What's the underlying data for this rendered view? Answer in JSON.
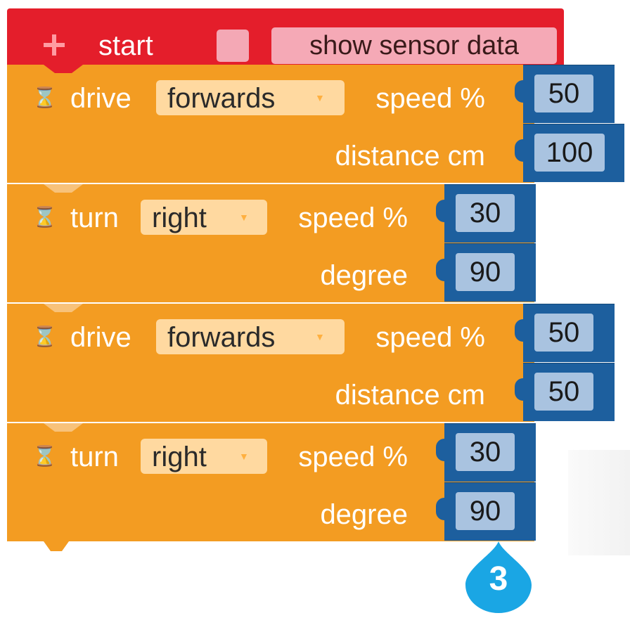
{
  "hat": {
    "plus_icon": "plus-icon",
    "label": "start",
    "option_label": "show sensor data",
    "color": "#e41e2b"
  },
  "blocks": [
    {
      "action": "drive",
      "direction": "forwards",
      "param1": "speed %",
      "value1": "50",
      "param2": "distance cm",
      "value2": "100"
    },
    {
      "action": "turn",
      "direction": "right",
      "param1": "speed %",
      "value1": "30",
      "param2": "degree",
      "value2": "90"
    },
    {
      "action": "drive",
      "direction": "forwards",
      "param1": "speed %",
      "value1": "50",
      "param2": "distance cm",
      "value2": "50"
    },
    {
      "action": "turn",
      "direction": "right",
      "param1": "speed %",
      "value1": "30",
      "param2": "degree",
      "value2": "90"
    }
  ],
  "callout": {
    "number": "3",
    "color": "#1aa6e4"
  },
  "colors": {
    "block": "#f39c22",
    "socket": "#1d5f9e",
    "field": "#a9c3e0"
  }
}
